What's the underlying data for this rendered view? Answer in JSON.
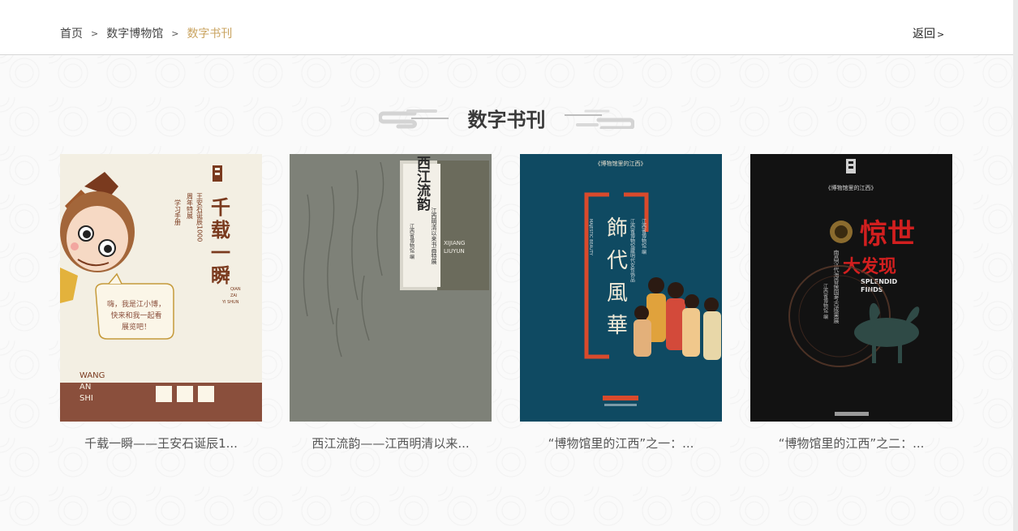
{
  "breadcrumb": {
    "home": "首页",
    "museum": "数字博物馆",
    "current": "数字书刊",
    "separator": ">"
  },
  "back": {
    "label": "返回",
    "chevron": ">"
  },
  "section": {
    "title": "数字书刊"
  },
  "colors": {
    "accent_gold": "#c9a35f",
    "cover1_bg": "#f3efe3",
    "cover2_bg": "#7e8178",
    "cover3_bg": "#0f4a62",
    "cover4_bg": "#121212",
    "accent_red": "#d94a2c"
  },
  "books": [
    {
      "caption": "千载一瞬——王安石诞辰1...",
      "cover": {
        "title_lines": [
          "千",
          "载",
          "一",
          "瞬"
        ],
        "subtitle_col1": "王安石诞辰1000",
        "subtitle_col2": "周年特展",
        "tag": "学习手册",
        "speech": [
          "嗨，我是江小博，",
          "快来和我一起看",
          "展览吧！"
        ],
        "name_lines": [
          "WANG",
          "AN",
          "SHI"
        ],
        "pinyin": [
          "QIAN",
          "ZAI",
          "YI SHUN"
        ]
      }
    },
    {
      "caption": "西江流韵——江西明清以来...",
      "cover": {
        "title": "西江流韵",
        "subtitle": "江西明清以来书画特展",
        "pinyin": [
          "XIJIANG",
          "LIUYUN"
        ],
        "publisher": "江西省博物馆 编"
      }
    },
    {
      "caption": "“博物馆里的江西”之一：...",
      "cover": {
        "series": "《博物馆里的江西》",
        "title_chars": [
          "飾",
          "代",
          "風",
          "華"
        ],
        "english": "MAJESTIC BEAUTY",
        "subtitle": "江西省博物馆藏明代女性饰品",
        "publisher": "江西省博物馆 编"
      }
    },
    {
      "caption": "“博物馆里的江西”之二：...",
      "cover": {
        "series": "《博物馆里的江西》",
        "title_line1": "惊世",
        "title_line2": "大发现",
        "english": [
          "SPLENDID",
          "FINDS"
        ],
        "subtitle": "南昌汉代海昏侯国考古成果展",
        "publisher": "江西省博物馆 编"
      }
    }
  ]
}
